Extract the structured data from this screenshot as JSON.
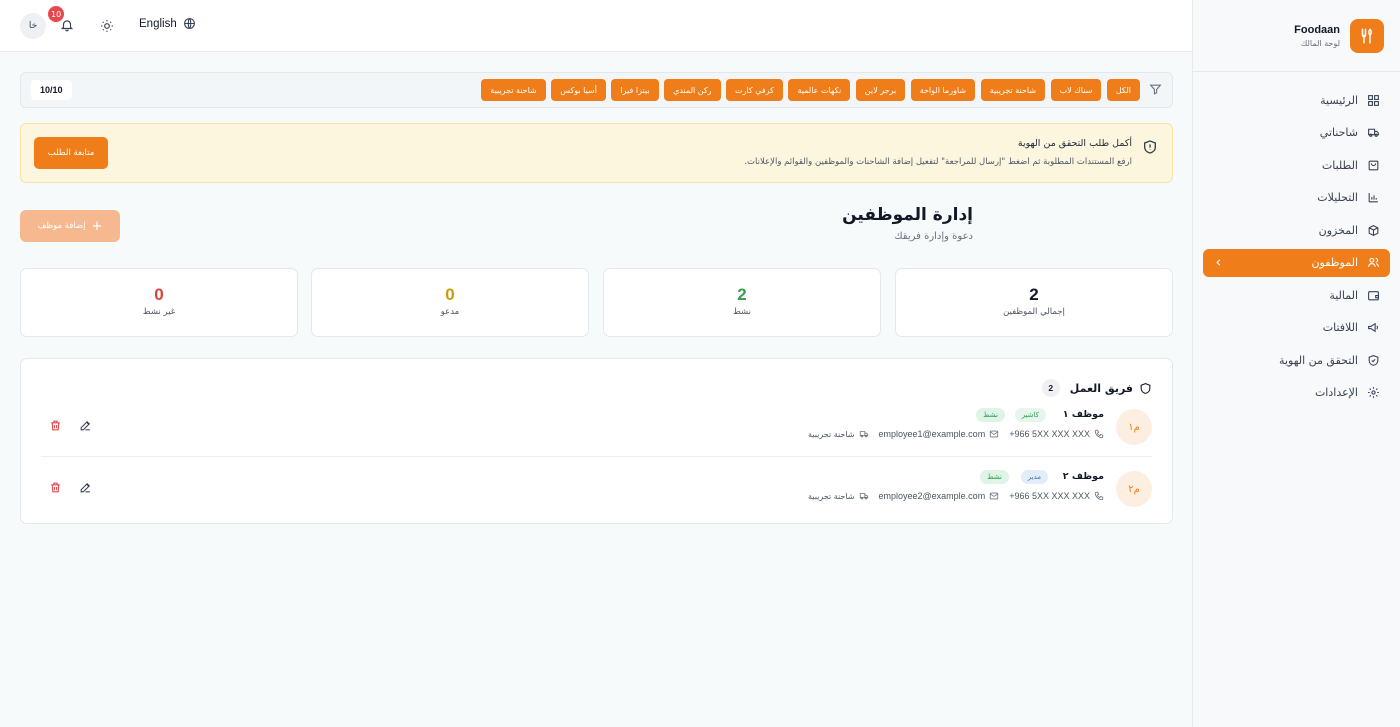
{
  "brand": {
    "name": "Foodaan",
    "subtitle": "لوحة المالك"
  },
  "sidebar": {
    "items": [
      {
        "label": "الرئيسية",
        "icon": "dashboard-icon"
      },
      {
        "label": "شاحناتي",
        "icon": "truck-icon"
      },
      {
        "label": "الطلبات",
        "icon": "orders-icon"
      },
      {
        "label": "التحليلات",
        "icon": "chart-icon"
      },
      {
        "label": "المخزون",
        "icon": "box-icon"
      },
      {
        "label": "الموظفون",
        "icon": "users-icon",
        "active": true
      },
      {
        "label": "المالية",
        "icon": "wallet-icon"
      },
      {
        "label": "اللافتات",
        "icon": "megaphone-icon"
      },
      {
        "label": "التحقق من الهوية",
        "icon": "shield-check-icon"
      },
      {
        "label": "الإعدادات",
        "icon": "gear-icon"
      }
    ]
  },
  "header": {
    "avatar": "خا",
    "notifications": "10",
    "language": "English"
  },
  "filters": {
    "chips": [
      "الكل",
      "سناك لاب",
      "شاحنة تجريبية",
      "شاورما الواحة",
      "برجر لاين",
      "نكهات عالمية",
      "كرفي كارت",
      "ركن المندي",
      "بيتزا فيرا",
      "أسيا بوكس",
      "شاحنة تجريبية"
    ],
    "count": "10/10"
  },
  "alert": {
    "title": "أكمل طلب التحقق من الهوية",
    "description": "ارفع المستندات المطلوبة ثم اضغط \"إرسال للمراجعة\" لتفعيل إضافة الشاحنات والموظفين والقوائم والإعلانات.",
    "button": "متابعة الطلب"
  },
  "page": {
    "title": "إدارة الموظفين",
    "subtitle": "دعوة وإدارة فريقك",
    "add_button": "إضافة موظف"
  },
  "stats": [
    {
      "value": "2",
      "label": "إجمالي الموظفين",
      "color": "#111827"
    },
    {
      "value": "2",
      "label": "نشط",
      "color": "#3a9a4f"
    },
    {
      "value": "0",
      "label": "مدعو",
      "color": "#c99a0e"
    },
    {
      "value": "0",
      "label": "غير نشط",
      "color": "#d94438"
    }
  ],
  "team": {
    "title": "فريق العمل",
    "count": "2",
    "employees": [
      {
        "initials": "م١",
        "name": "موظف ١",
        "role": "كاشير",
        "status": "نشط",
        "phone": "+966 5XX XXX XXX",
        "email": "employee1@example.com",
        "truck": "شاحنة تجريبية"
      },
      {
        "initials": "م٢",
        "name": "موظف ٢",
        "role": "مدير",
        "status": "نشط",
        "phone": "+966 5XX XXX XXX",
        "email": "employee2@example.com",
        "truck": "شاحنة تجريبية"
      }
    ]
  },
  "colors": {
    "accent": "#ef7d1a",
    "danger": "#e5484d"
  }
}
